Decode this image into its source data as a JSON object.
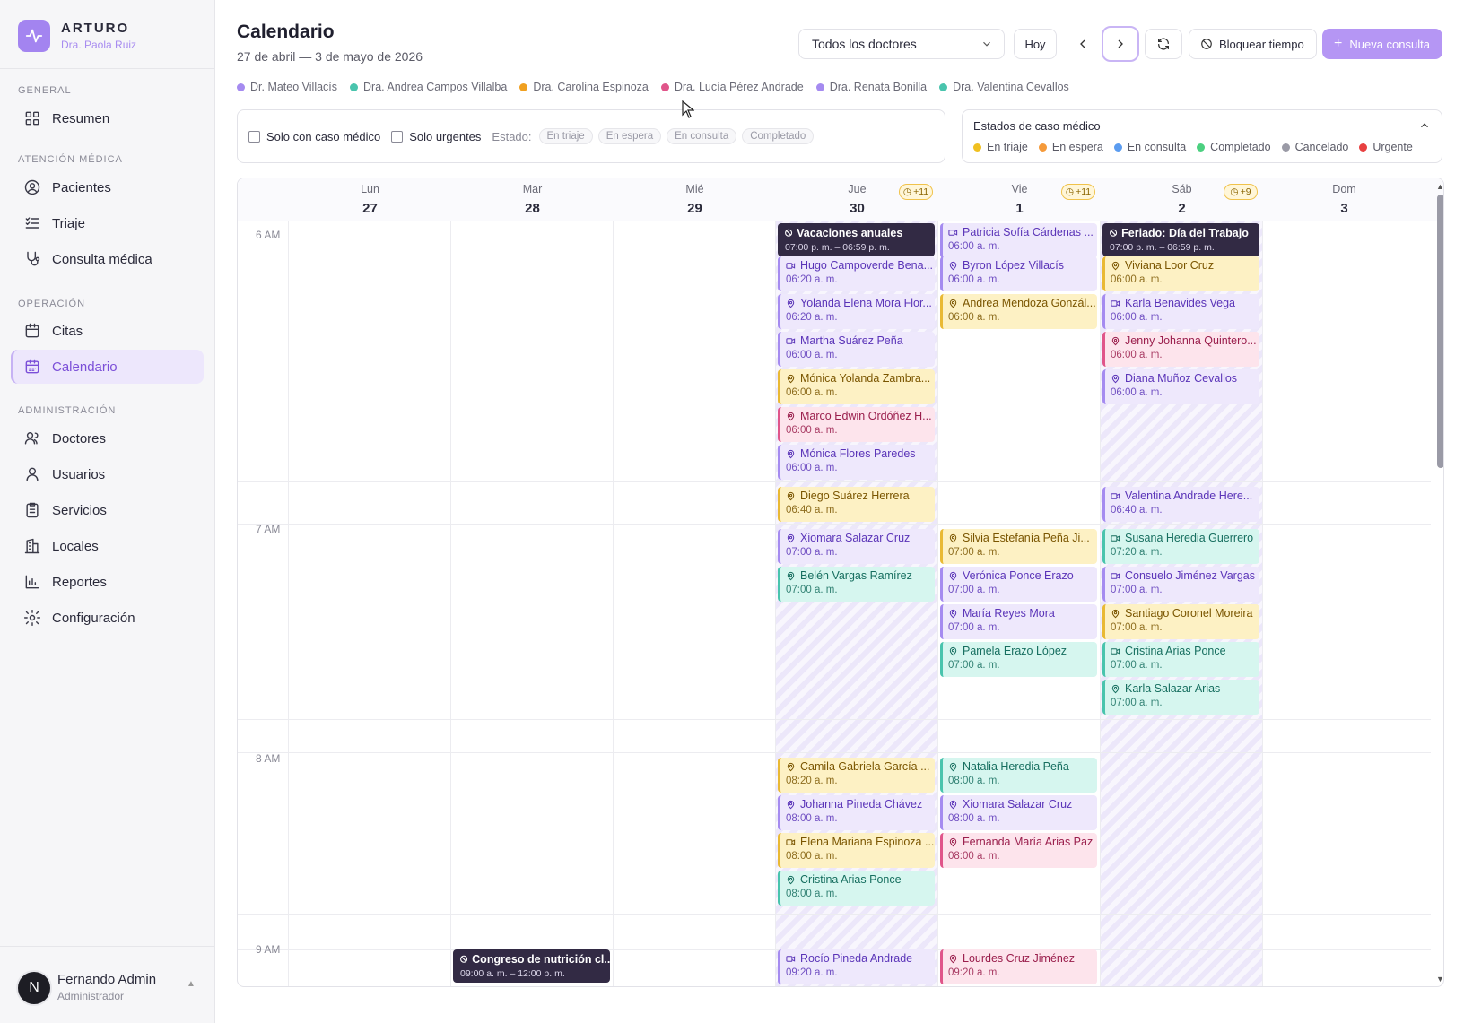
{
  "brand": {
    "name": "ARTURO",
    "subtitle": "Dra. Paola Ruiz",
    "logo_icon": "pulse-icon",
    "accent": "#a384f0"
  },
  "sidebar": {
    "sections": {
      "general": "GENERAL",
      "atencion": "ATENCIÓN MÉDICA",
      "operacion": "OPERACIÓN",
      "admin": "ADMINISTRACIÓN"
    },
    "items": [
      {
        "label": "Resumen",
        "icon": "grid-icon"
      },
      {
        "label": "Pacientes",
        "icon": "user-circle-icon"
      },
      {
        "label": "Triaje",
        "icon": "list-check-icon"
      },
      {
        "label": "Consulta médica",
        "icon": "stethoscope-icon"
      },
      {
        "label": "Citas",
        "icon": "calendar-icon"
      },
      {
        "label": "Calendario",
        "icon": "calendar-grid-icon",
        "active": true
      },
      {
        "label": "Doctores",
        "icon": "users-icon"
      },
      {
        "label": "Usuarios",
        "icon": "user-icon"
      },
      {
        "label": "Servicios",
        "icon": "clipboard-icon"
      },
      {
        "label": "Locales",
        "icon": "building-icon"
      },
      {
        "label": "Reportes",
        "icon": "bar-chart-icon"
      },
      {
        "label": "Configuración",
        "icon": "gear-icon"
      }
    ],
    "user": {
      "initial": "N",
      "name": "Fernando Admin",
      "role": "Administrador"
    }
  },
  "header": {
    "title": "Calendario",
    "range": "27 de abril — 3 de mayo de 2026",
    "doctor_select": "Todos los doctores",
    "today_label": "Hoy",
    "block_label": "Bloquear tiempo",
    "new_label": "Nueva consulta"
  },
  "doctors": [
    {
      "name": "Dr. Mateo Villacís",
      "color": "#a58bf0"
    },
    {
      "name": "Dra. Andrea Campos Villalba",
      "color": "#49c4ad"
    },
    {
      "name": "Dra. Carolina Espinoza",
      "color": "#f0a020"
    },
    {
      "name": "Dra. Lucía Pérez Andrade",
      "color": "#e0558a"
    },
    {
      "name": "Dra. Renata Bonilla",
      "color": "#a58bf0"
    },
    {
      "name": "Dra. Valentina Cevallos",
      "color": "#49c4ad"
    }
  ],
  "filters": {
    "solo_caso": "Solo con caso médico",
    "solo_urgentes": "Solo urgentes",
    "estado_label": "Estado:",
    "chips": [
      "En triaje",
      "En espera",
      "En consulta",
      "Completado"
    ]
  },
  "status_legend": {
    "title": "Estados de caso médico",
    "items": [
      {
        "label": "En triaje",
        "color": "#f0c020"
      },
      {
        "label": "En espera",
        "color": "#f59a3a"
      },
      {
        "label": "En consulta",
        "color": "#5b9cf0"
      },
      {
        "label": "Completado",
        "color": "#4cd080"
      },
      {
        "label": "Cancelado",
        "color": "#9a9aa6"
      },
      {
        "label": "Urgente",
        "color": "#e84040"
      }
    ]
  },
  "calendar": {
    "days": [
      {
        "name": "Lun",
        "num": "27",
        "badge": ""
      },
      {
        "name": "Mar",
        "num": "28",
        "badge": ""
      },
      {
        "name": "Mié",
        "num": "29",
        "badge": ""
      },
      {
        "name": "Jue",
        "num": "30",
        "badge": "+11"
      },
      {
        "name": "Vie",
        "num": "1",
        "badge": "+11"
      },
      {
        "name": "Sáb",
        "num": "2",
        "badge": "+9"
      },
      {
        "name": "Dom",
        "num": "3",
        "badge": ""
      }
    ],
    "time_labels": [
      "6 AM",
      "7 AM",
      "8 AM",
      "9 AM"
    ],
    "blocks": [
      {
        "day": 3,
        "slot": 0,
        "title": "Vacaciones anuales",
        "time": "07:00 p. m. – 06:59 p. m."
      },
      {
        "day": 5,
        "slot": 0,
        "title": "Feriado: Día del Trabajo",
        "time": "07:00 p. m. – 06:59 p. m."
      },
      {
        "day": 1,
        "slot": 19,
        "title": "Congreso de nutrición cl...",
        "time": "09:00 a. m. – 12:00 p. m."
      }
    ],
    "events": [
      {
        "day": 3,
        "slot": 1,
        "name": "Hugo Campoverde Bena...",
        "time": "06:20 a. m.",
        "color": "purple",
        "kind": "video"
      },
      {
        "day": 3,
        "slot": 2,
        "name": "Yolanda Elena Mora Flor...",
        "time": "06:20 a. m.",
        "color": "purple",
        "kind": "pin"
      },
      {
        "day": 3,
        "slot": 3,
        "name": "Martha Suárez Peña",
        "time": "06:00 a. m.",
        "color": "purple",
        "kind": "video"
      },
      {
        "day": 3,
        "slot": 4,
        "name": "Mónica Yolanda Zambra...",
        "time": "06:00 a. m.",
        "color": "yellow",
        "kind": "pin"
      },
      {
        "day": 3,
        "slot": 5,
        "name": "Marco Edwin Ordóñez H...",
        "time": "06:00 a. m.",
        "color": "pink",
        "kind": "pin"
      },
      {
        "day": 3,
        "slot": 6,
        "name": "Mónica Flores Paredes",
        "time": "06:00 a. m.",
        "color": "purple",
        "kind": "pin"
      },
      {
        "day": 3,
        "slot": 7,
        "name": "Diego Suárez Herrera",
        "time": "06:40 a. m.",
        "color": "yellow",
        "kind": "pin"
      },
      {
        "day": 3,
        "slot": 8,
        "name": "Xiomara Salazar Cruz",
        "time": "07:00 a. m.",
        "color": "purple",
        "kind": "pin"
      },
      {
        "day": 3,
        "slot": 9,
        "name": "Belén Vargas Ramírez",
        "time": "07:00 a. m.",
        "color": "teal",
        "kind": "pin"
      },
      {
        "day": 3,
        "slot": 14,
        "name": "Camila Gabriela García ...",
        "time": "08:20 a. m.",
        "color": "yellow",
        "kind": "pin"
      },
      {
        "day": 3,
        "slot": 15,
        "name": "Johanna Pineda Chávez",
        "time": "08:00 a. m.",
        "color": "purple",
        "kind": "pin"
      },
      {
        "day": 3,
        "slot": 16,
        "name": "Elena Mariana Espinoza ...",
        "time": "08:00 a. m.",
        "color": "yellow",
        "kind": "video"
      },
      {
        "day": 3,
        "slot": 17,
        "name": "Cristina Arias Ponce",
        "time": "08:00 a. m.",
        "color": "teal",
        "kind": "pin"
      },
      {
        "day": 3,
        "slot": 19,
        "name": "Rocío Pineda Andrade",
        "time": "09:20 a. m.",
        "color": "purple",
        "kind": "video"
      },
      {
        "day": 4,
        "slot": 0,
        "name": "Patricia Sofía Cárdenas ...",
        "time": "06:00 a. m.",
        "color": "purple",
        "kind": "video"
      },
      {
        "day": 4,
        "slot": 1,
        "name": "Byron López Villacís",
        "time": "06:00 a. m.",
        "color": "purple",
        "kind": "pin"
      },
      {
        "day": 4,
        "slot": 2,
        "name": "Andrea Mendoza Gonzál...",
        "time": "06:00 a. m.",
        "color": "yellow",
        "kind": "pin"
      },
      {
        "day": 4,
        "slot": 8,
        "name": "Silvia Estefanía Peña Ji...",
        "time": "07:00 a. m.",
        "color": "yellow",
        "kind": "pin"
      },
      {
        "day": 4,
        "slot": 9,
        "name": "Verónica Ponce Erazo",
        "time": "07:00 a. m.",
        "color": "purple",
        "kind": "pin"
      },
      {
        "day": 4,
        "slot": 10,
        "name": "María Reyes Mora",
        "time": "07:00 a. m.",
        "color": "purple",
        "kind": "pin"
      },
      {
        "day": 4,
        "slot": 11,
        "name": "Pamela Erazo López",
        "time": "07:00 a. m.",
        "color": "teal",
        "kind": "pin"
      },
      {
        "day": 4,
        "slot": 14,
        "name": "Natalia Heredia Peña",
        "time": "08:00 a. m.",
        "color": "teal",
        "kind": "pin"
      },
      {
        "day": 4,
        "slot": 15,
        "name": "Xiomara Salazar Cruz",
        "time": "08:00 a. m.",
        "color": "purple",
        "kind": "pin"
      },
      {
        "day": 4,
        "slot": 16,
        "name": "Fernanda María Arias Paz",
        "time": "08:00 a. m.",
        "color": "pink",
        "kind": "pin"
      },
      {
        "day": 4,
        "slot": 19,
        "name": "Lourdes Cruz Jiménez",
        "time": "09:20 a. m.",
        "color": "pink",
        "kind": "pin"
      },
      {
        "day": 5,
        "slot": 1,
        "name": "Viviana Loor Cruz",
        "time": "06:00 a. m.",
        "color": "yellow",
        "kind": "pin"
      },
      {
        "day": 5,
        "slot": 2,
        "name": "Karla Benavides Vega",
        "time": "06:00 a. m.",
        "color": "purple",
        "kind": "video"
      },
      {
        "day": 5,
        "slot": 3,
        "name": "Jenny Johanna Quintero...",
        "time": "06:00 a. m.",
        "color": "pink",
        "kind": "pin"
      },
      {
        "day": 5,
        "slot": 4,
        "name": "Diana Muñoz Cevallos",
        "time": "06:00 a. m.",
        "color": "purple",
        "kind": "pin"
      },
      {
        "day": 5,
        "slot": 7,
        "name": "Valentina Andrade Here...",
        "time": "06:40 a. m.",
        "color": "purple",
        "kind": "video"
      },
      {
        "day": 5,
        "slot": 8,
        "name": "Susana Heredia Guerrero",
        "time": "07:20 a. m.",
        "color": "teal",
        "kind": "video"
      },
      {
        "day": 5,
        "slot": 9,
        "name": "Consuelo Jiménez Vargas",
        "time": "07:00 a. m.",
        "color": "purple",
        "kind": "video"
      },
      {
        "day": 5,
        "slot": 10,
        "name": "Santiago Coronel Moreira",
        "time": "07:00 a. m.",
        "color": "yellow",
        "kind": "pin"
      },
      {
        "day": 5,
        "slot": 11,
        "name": "Cristina Arias Ponce",
        "time": "07:00 a. m.",
        "color": "teal",
        "kind": "video"
      },
      {
        "day": 5,
        "slot": 12,
        "name": "Karla Salazar Arias",
        "time": "07:00 a. m.",
        "color": "teal",
        "kind": "pin"
      }
    ]
  }
}
